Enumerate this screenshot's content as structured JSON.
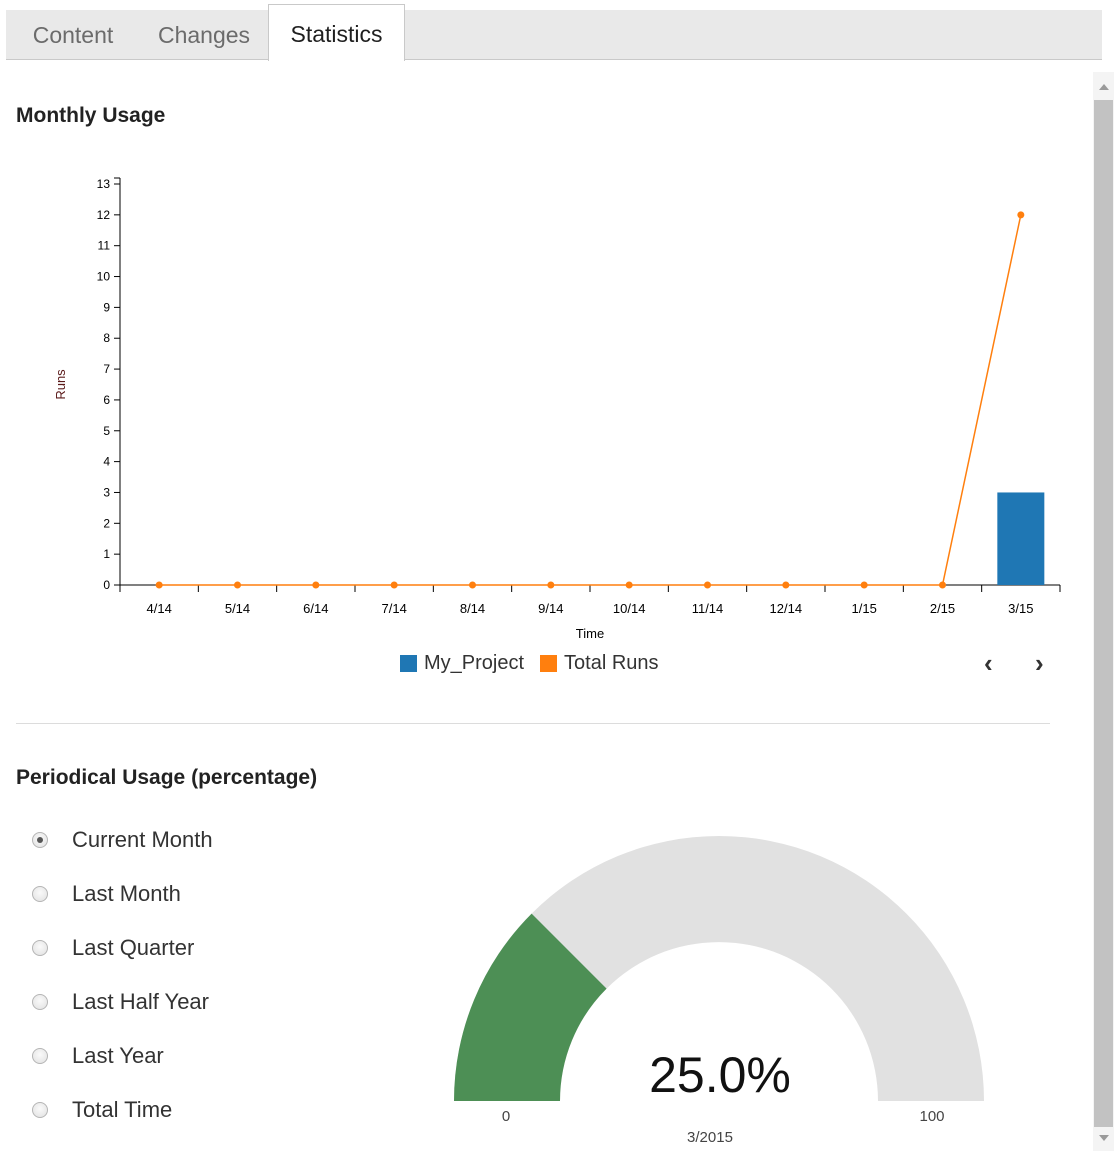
{
  "tabs": [
    {
      "label": "Content",
      "active": false
    },
    {
      "label": "Changes",
      "active": false
    },
    {
      "label": "Statistics",
      "active": true
    }
  ],
  "monthly_usage": {
    "title": "Monthly Usage"
  },
  "chart_data": {
    "type": "bar",
    "title": "",
    "xlabel": "Time",
    "ylabel": "Runs",
    "categories": [
      "4/14",
      "5/14",
      "6/14",
      "7/14",
      "8/14",
      "9/14",
      "10/14",
      "11/14",
      "12/14",
      "1/15",
      "2/15",
      "3/15"
    ],
    "ylim": [
      0,
      13
    ],
    "yticks": [
      "0",
      "1",
      "2",
      "3",
      "4",
      "5",
      "6",
      "7",
      "8",
      "9",
      "10",
      "11",
      "12",
      "13"
    ],
    "series": [
      {
        "name": "My_Project",
        "type": "bar",
        "color": "#1f77b4",
        "values": [
          0,
          0,
          0,
          0,
          0,
          0,
          0,
          0,
          0,
          0,
          0,
          3
        ]
      },
      {
        "name": "Total Runs",
        "type": "line",
        "color": "#ff7f0e",
        "values": [
          0,
          0,
          0,
          0,
          0,
          0,
          0,
          0,
          0,
          0,
          0,
          12
        ]
      }
    ],
    "legend_position": "bottom"
  },
  "chart_nav": {
    "prev_icon": "chevron-left-icon",
    "prev_glyph": "‹",
    "next_icon": "chevron-right-icon",
    "next_glyph": "›"
  },
  "periodical_usage": {
    "title": "Periodical Usage (percentage)",
    "options": [
      {
        "label": "Current Month",
        "checked": true
      },
      {
        "label": "Last Month",
        "checked": false
      },
      {
        "label": "Last Quarter",
        "checked": false
      },
      {
        "label": "Last Half Year",
        "checked": false
      },
      {
        "label": "Last Year",
        "checked": false
      },
      {
        "label": "Total Time",
        "checked": false
      }
    ],
    "gauge": {
      "value_percent": 25.0,
      "value_label": "25.0%",
      "min_label": "0",
      "max_label": "100",
      "period_label": "3/2015",
      "fill_color": "#4d8f55",
      "track_color": "#e1e1e1"
    }
  }
}
